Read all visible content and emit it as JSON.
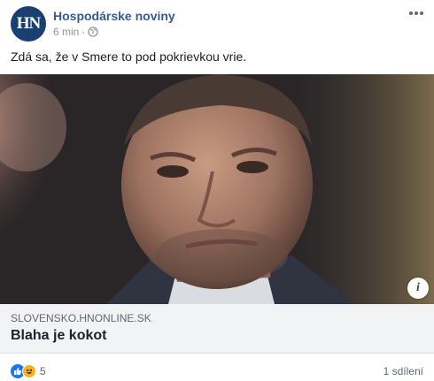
{
  "post": {
    "page_name": "Hospodárske noviny",
    "avatar_text": "HN",
    "time": "6 min",
    "separator": "·",
    "text": "Zdá sa, že v Smere to pod pokrievkou vrie.",
    "more_icon": "more-horizontal-icon",
    "privacy_icon": "globe-icon"
  },
  "link": {
    "image_icon": "info-icon",
    "info_glyph": "i",
    "domain": "SLOVENSKO.HNONLINE.SK",
    "title": "Blaha je kokot"
  },
  "footer": {
    "reaction_icons": [
      "like-icon",
      "haha-icon"
    ],
    "reaction_count": "5",
    "shares": "1 sdílení"
  },
  "colors": {
    "brand_blue": "#385898",
    "avatar_bg": "#1a3f73",
    "like_blue": "#1877f2",
    "haha_yellow": "#f7b125"
  }
}
